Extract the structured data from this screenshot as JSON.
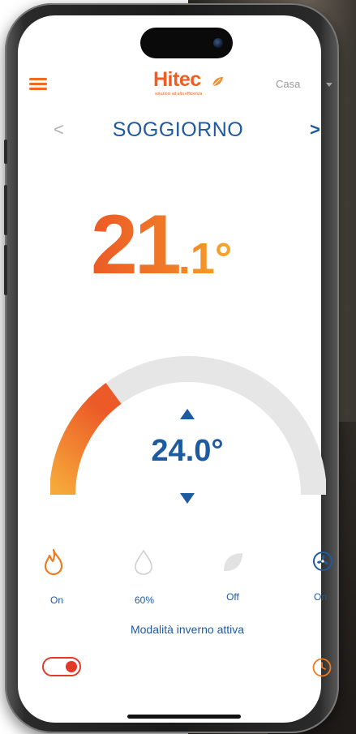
{
  "header": {
    "logo_text": "Hitec",
    "logo_subtitle": "soluzioni ad alta efficienza",
    "home_select": "Casa"
  },
  "room": {
    "name": "SOGGIORNO",
    "prev_symbol": "<",
    "next_symbol": ">"
  },
  "temperature": {
    "integer": "21",
    "decimal": ".1°"
  },
  "setpoint": {
    "value": "24.0°"
  },
  "status": {
    "heating_label": "On",
    "humidity_label": "60%",
    "eco_label": "Off",
    "fan_label": "On",
    "mode_text": "Modalità inverno attiva"
  },
  "toggle": {
    "state": "on"
  },
  "colors": {
    "accent_orange": "#ef5d24",
    "brand_blue": "#1e5aa0",
    "gauge_track": "#e6e6e6",
    "toggle_red": "#e23a2a"
  },
  "icons": [
    "menu-icon",
    "flame-icon",
    "drop-icon",
    "leaf-icon",
    "fan-icon",
    "clock-icon"
  ]
}
